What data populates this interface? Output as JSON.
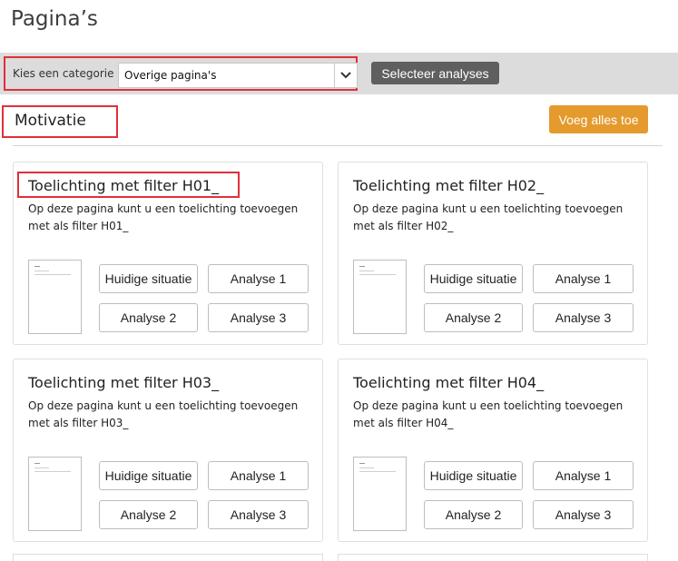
{
  "page": {
    "title": "Pagina’s"
  },
  "filter": {
    "category_label": "Kies een categorie",
    "category_value": "Overige pagina's",
    "select_analyses_label": "Selecteer analyses"
  },
  "section": {
    "title": "Motivatie",
    "add_all_label": "Voeg alles toe"
  },
  "cards": [
    {
      "title": "Toelichting met filter H01_",
      "desc": "Op deze pagina kunt u een toelichting toevoegen met als filter H01_",
      "buttons": [
        "Huidige situatie",
        "Analyse 1",
        "Analyse 2",
        "Analyse 3"
      ]
    },
    {
      "title": "Toelichting met filter H02_",
      "desc": "Op deze pagina kunt u een toelichting toevoegen met als filter H02_",
      "buttons": [
        "Huidige situatie",
        "Analyse 1",
        "Analyse 2",
        "Analyse 3"
      ]
    },
    {
      "title": "Toelichting met filter H03_",
      "desc": "Op deze pagina kunt u een toelichting toevoegen met als filter H03_",
      "buttons": [
        "Huidige situatie",
        "Analyse 1",
        "Analyse 2",
        "Analyse 3"
      ]
    },
    {
      "title": "Toelichting met filter H04_",
      "desc": "Op deze pagina kunt u een toelichting toevoegen met als filter H04_",
      "buttons": [
        "Huidige situatie",
        "Analyse 1",
        "Analyse 2",
        "Analyse 3"
      ]
    }
  ],
  "colors": {
    "accent_orange": "#e49a2c",
    "button_dark": "#5f5f5f",
    "highlight_red": "#e0303a",
    "filter_bar_bg": "#dcdcdc"
  },
  "icons": {
    "dropdown": "chevron-down-icon",
    "thumbnail": "page-thumbnail-icon"
  }
}
